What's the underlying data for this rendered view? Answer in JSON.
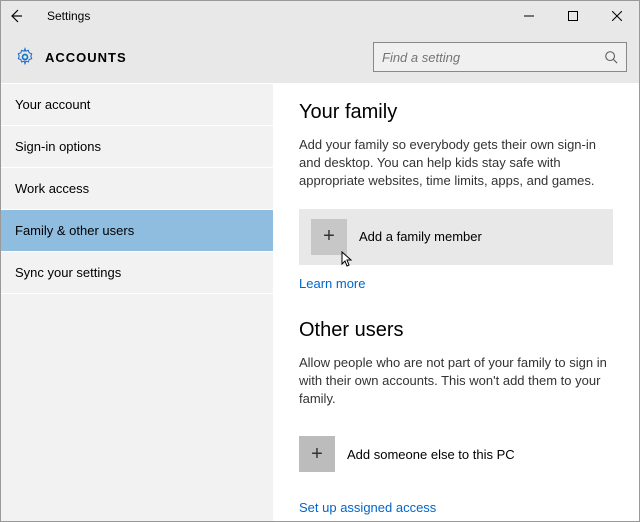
{
  "window": {
    "title": "Settings"
  },
  "header": {
    "title": "ACCOUNTS",
    "search_placeholder": "Find a setting"
  },
  "sidebar": {
    "items": [
      {
        "label": "Your account",
        "selected": false
      },
      {
        "label": "Sign-in options",
        "selected": false
      },
      {
        "label": "Work access",
        "selected": false
      },
      {
        "label": "Family & other users",
        "selected": true
      },
      {
        "label": "Sync your settings",
        "selected": false
      }
    ]
  },
  "content": {
    "family": {
      "title": "Your family",
      "desc": "Add your family so everybody gets their own sign-in and desktop. You can help kids stay safe with appropriate websites, time limits, apps, and games.",
      "add_label": "Add a family member",
      "learn_more": "Learn more"
    },
    "others": {
      "title": "Other users",
      "desc": "Allow people who are not part of your family to sign in with their own accounts. This won't add them to your family.",
      "add_label": "Add someone else to this PC",
      "assigned_link": "Set up assigned access"
    }
  }
}
